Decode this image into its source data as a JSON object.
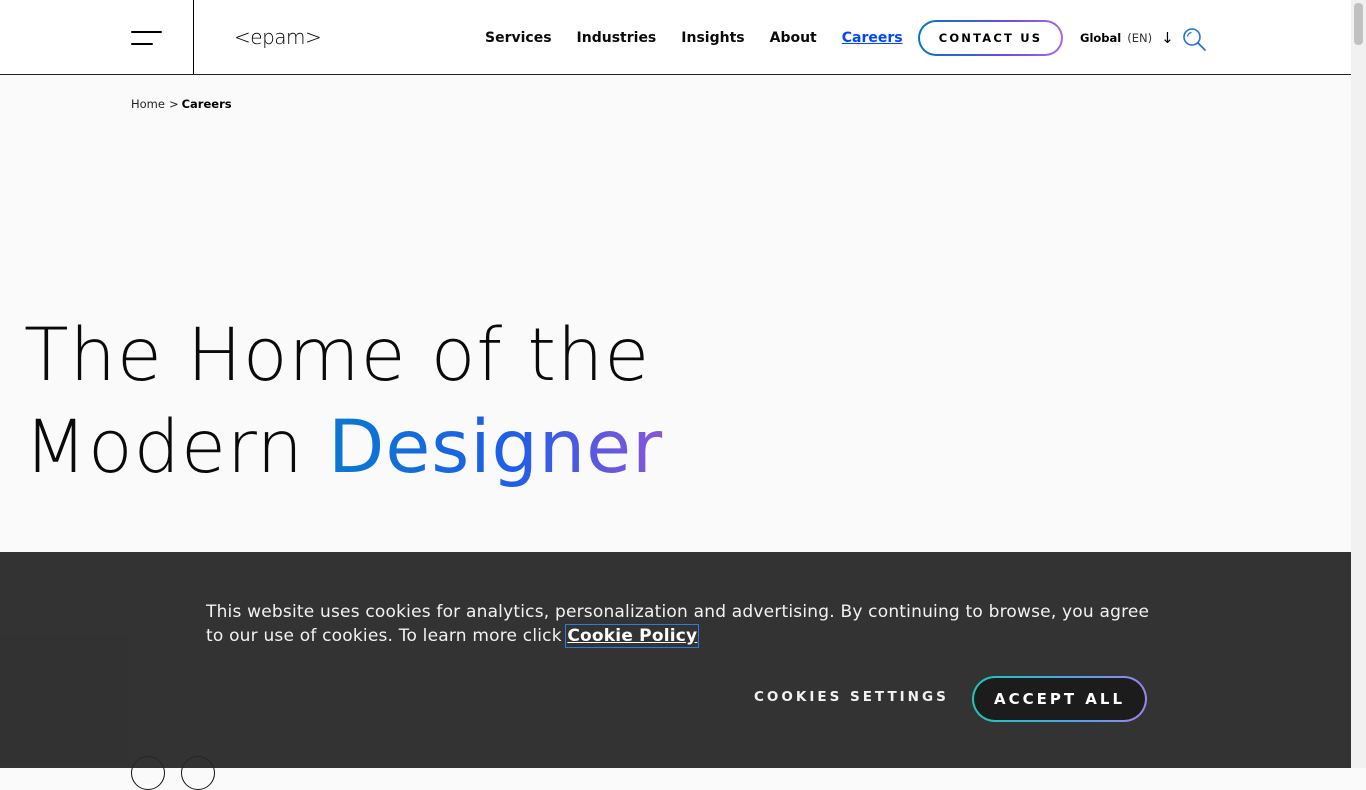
{
  "header": {
    "logo_text": "<epam>",
    "nav": [
      {
        "label": "Services"
      },
      {
        "label": "Industries"
      },
      {
        "label": "Insights"
      },
      {
        "label": "About"
      },
      {
        "label": "Careers",
        "active": true
      }
    ],
    "contact_label": "CONTACT US",
    "lang_region": "Global",
    "lang_code": "(EN)",
    "icons": [
      "menu-icon",
      "chevron-down-icon",
      "search-icon"
    ]
  },
  "breadcrumb": {
    "home": "Home",
    "separator": ">",
    "current": "Careers"
  },
  "hero": {
    "line1": "The Home of the",
    "line2_prefix": "Modern ",
    "line2_accent": "Designer"
  },
  "cookie_banner": {
    "text": "This website uses cookies for analytics, personalization and advertising. By continuing to browse, you agree to our use of cookies. To learn more click ",
    "link": "Cookie Policy",
    "settings_label": "COOKIES SETTINGS",
    "accept_label": "ACCEPT ALL"
  },
  "colors": {
    "accent_blue": "#0047ff",
    "gradient_start": "#0a78d0",
    "gradient_end": "#8a55d8",
    "banner_bg": "#262626"
  }
}
